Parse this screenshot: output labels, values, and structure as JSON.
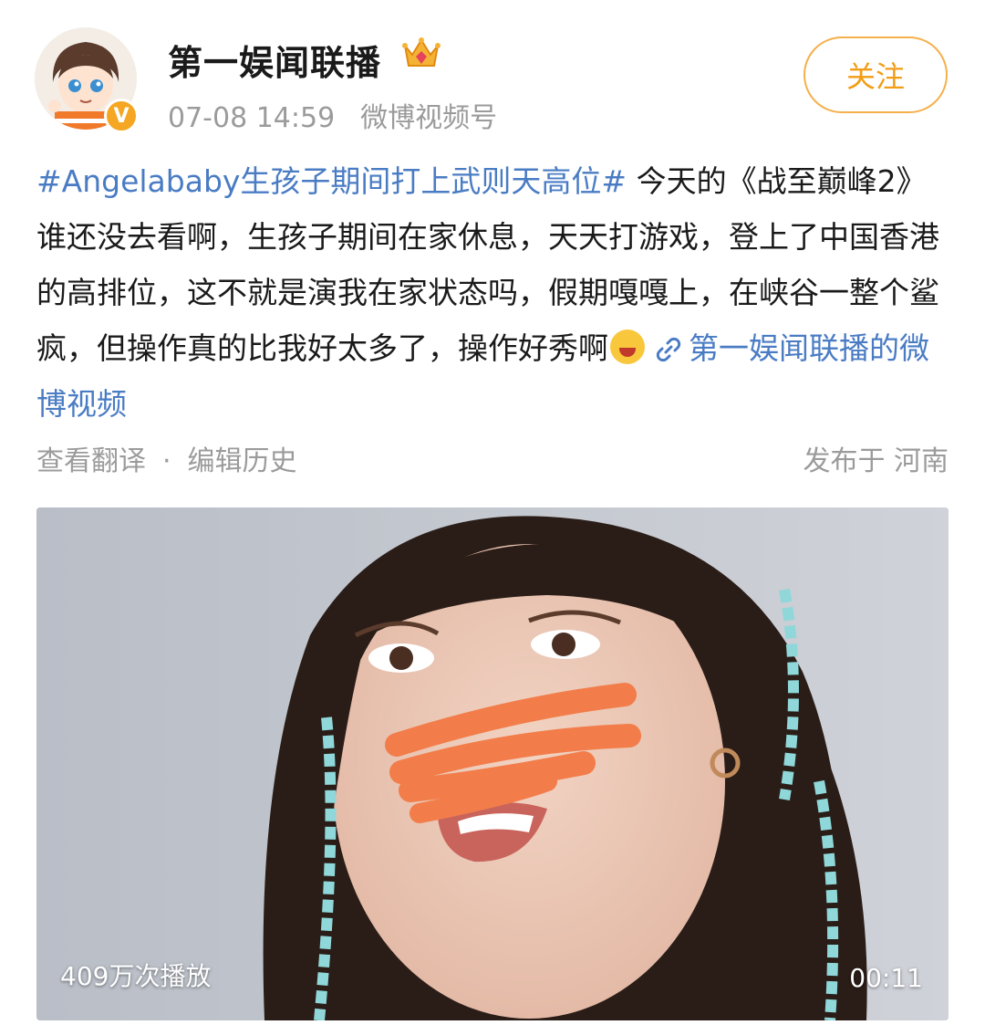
{
  "post": {
    "username": "第一娱闻联播",
    "time": "07-08 14:59",
    "source": "微博视频号",
    "follow_label": "关注",
    "topic": "#Angelababy生孩子期间打上武则天高位#",
    "body": " 今天的《战至巅峰2》谁还没去看啊，生孩子期间在家休息，天天打游戏，登上了中国香港的高排位，这不就是演我在家状态吗，假期嘎嘎上，在峡谷一整个鲨疯，但操作真的比我好太多了，操作好秀啊",
    "link_text": "第一娱闻联播的微博视频",
    "translate_label": "查看翻译",
    "separator": "·",
    "edit_history_label": "编辑历史",
    "published_location": "发布于 河南"
  },
  "video": {
    "play_count": "409万次播放",
    "duration": "00:11"
  },
  "icons": {
    "verified": "verified-badge-icon",
    "crown": "crown-icon",
    "emoji": "laughing-crying-emoji-icon",
    "link": "link-icon"
  },
  "colors": {
    "topic_link": "#4a7cc4",
    "follow_accent": "#f29d16",
    "meta_gray": "#9b9b9b",
    "redaction": "#f27d4a"
  }
}
